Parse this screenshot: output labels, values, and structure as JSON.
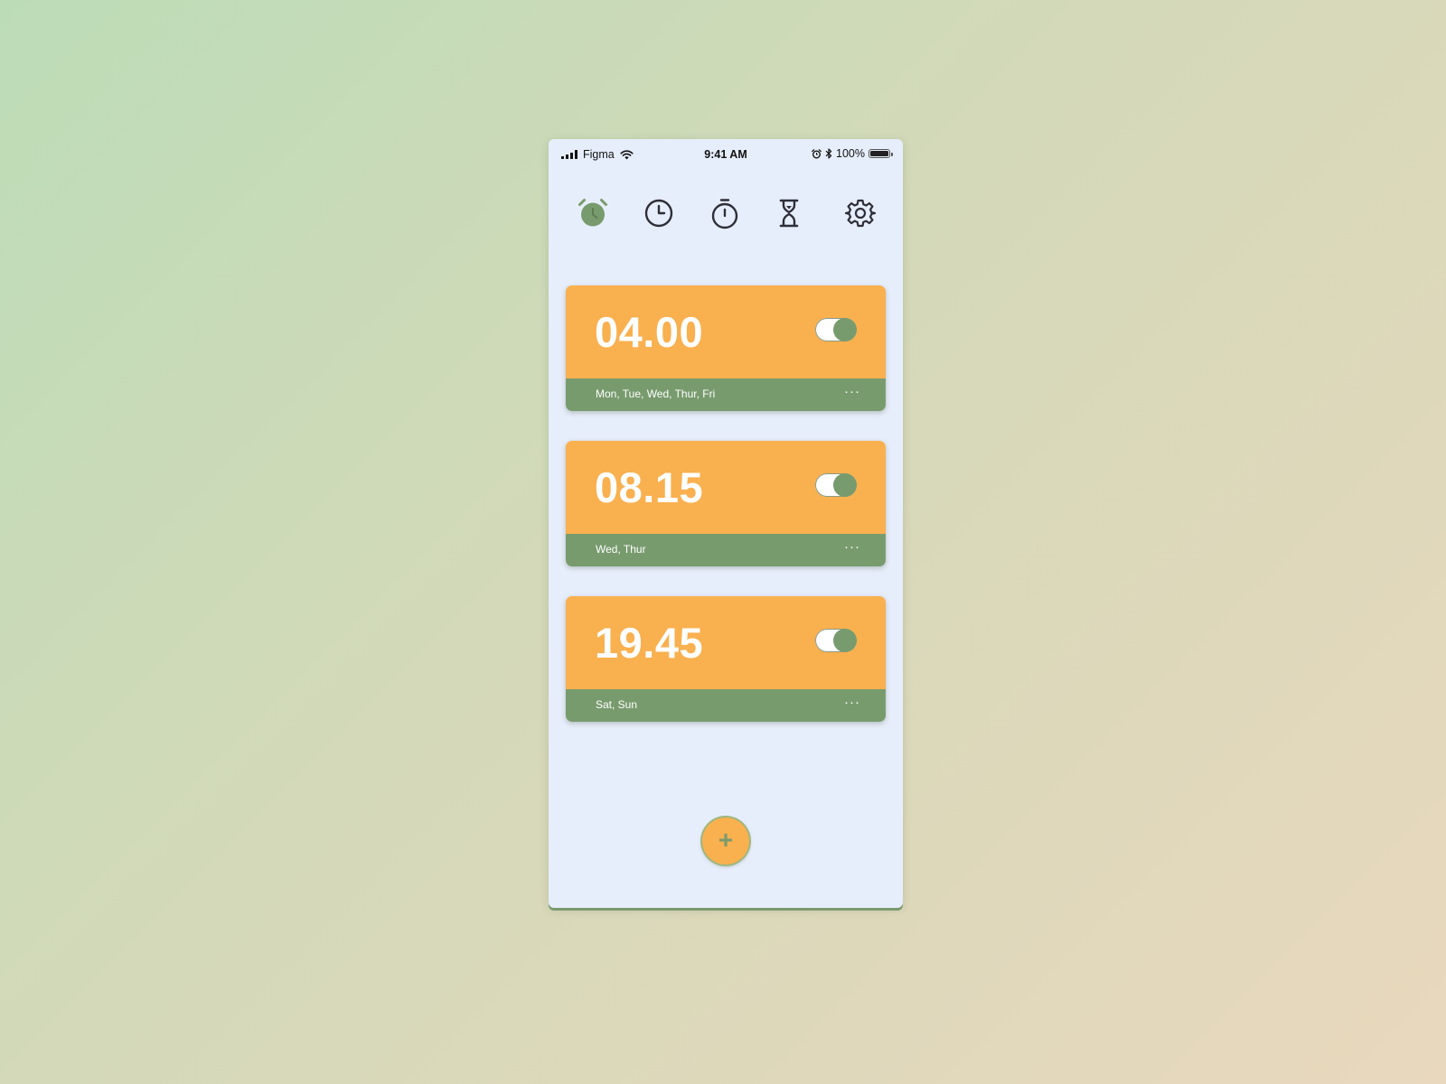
{
  "status_bar": {
    "carrier": "Figma",
    "time": "9:41 AM",
    "battery": "100%"
  },
  "nav": {
    "items": [
      {
        "icon": "alarm-icon",
        "active": true
      },
      {
        "icon": "clock-icon",
        "active": false
      },
      {
        "icon": "stopwatch-icon",
        "active": false
      },
      {
        "icon": "hourglass-icon",
        "active": false
      },
      {
        "icon": "gear-icon",
        "active": false
      }
    ]
  },
  "alarms": [
    {
      "time": "04.00",
      "days": "Mon, Tue, Wed, Thur, Fri",
      "enabled": true,
      "more": "···"
    },
    {
      "time": "08.15",
      "days": "Wed, Thur",
      "enabled": true,
      "more": "···"
    },
    {
      "time": "19.45",
      "days": "Sat, Sun",
      "enabled": true,
      "more": "···"
    }
  ],
  "fab": {
    "label": "+",
    "icon": "plus-icon"
  },
  "colors": {
    "card_orange": "#f9b04f",
    "card_green": "#789b6e",
    "screen_bg": "#e7eefb",
    "icon_dark": "#2e2e38"
  }
}
